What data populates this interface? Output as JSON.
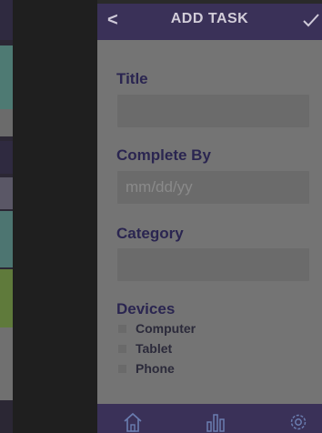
{
  "header": {
    "back_label": "<",
    "title": "ADD TASK"
  },
  "form": {
    "title_label": "Title",
    "title_value": "",
    "title_placeholder": "",
    "complete_by_label": "Complete By",
    "complete_by_placeholder": "mm/dd/yy",
    "category_label": "Category",
    "category_value": "",
    "devices_label": "Devices",
    "devices": [
      {
        "label": "Computer",
        "checked": false
      },
      {
        "label": "Tablet",
        "checked": false
      },
      {
        "label": "Phone",
        "checked": false
      }
    ]
  },
  "nav": {
    "items": [
      "home-icon",
      "stats-icon",
      "settings-icon"
    ]
  },
  "colors": {
    "header_bg": "#3a3158",
    "panel_bg": "#747474",
    "label_color": "#2a2550"
  }
}
